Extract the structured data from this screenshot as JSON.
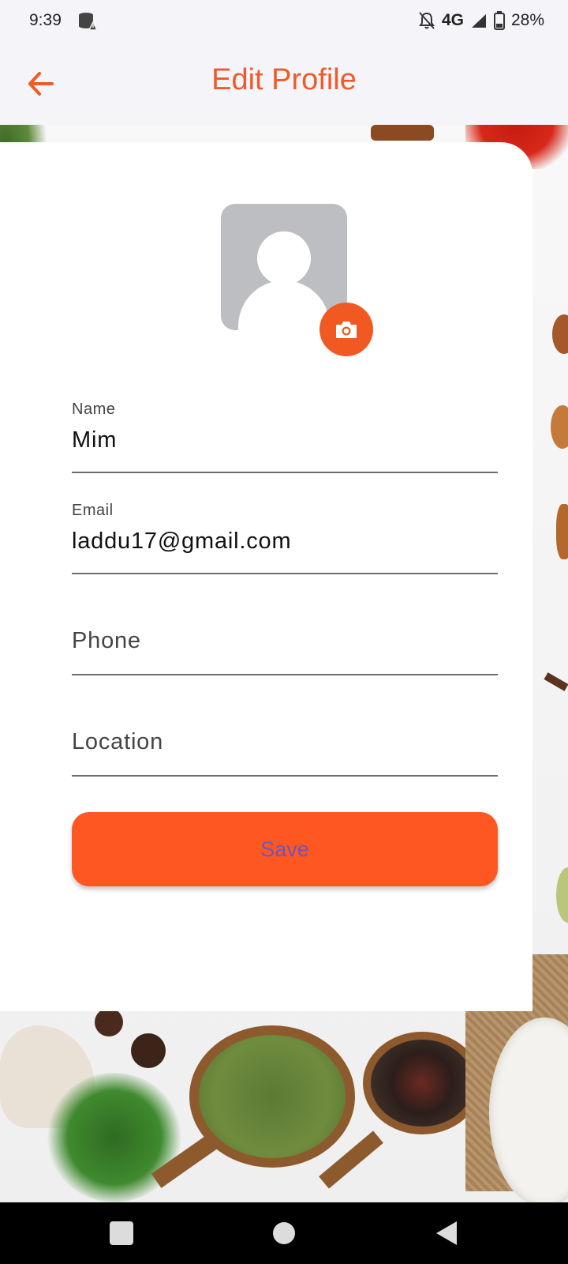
{
  "status_bar": {
    "time": "9:39",
    "network": "4G",
    "battery": "28%",
    "icons": [
      "database-warning-icon",
      "bell-off-icon",
      "signal-icon",
      "battery-icon"
    ]
  },
  "app_bar": {
    "title": "Edit Profile",
    "back_icon": "arrow-left-icon"
  },
  "profile": {
    "avatar_icon": "person-placeholder-icon",
    "camera_icon": "camera-icon"
  },
  "form": {
    "name": {
      "label": "Name",
      "value": "Mim"
    },
    "email": {
      "label": "Email",
      "value": "laddu17@gmail.com"
    },
    "phone": {
      "placeholder": "Phone"
    },
    "location": {
      "placeholder": "Location"
    },
    "save_label": "Save"
  },
  "nav": {
    "recents_icon": "square-icon",
    "home_icon": "circle-icon",
    "back_icon": "triangle-back-icon"
  },
  "colors": {
    "accent": "#f05a28",
    "button": "#ff5722",
    "button_text": "#6f56b5"
  }
}
